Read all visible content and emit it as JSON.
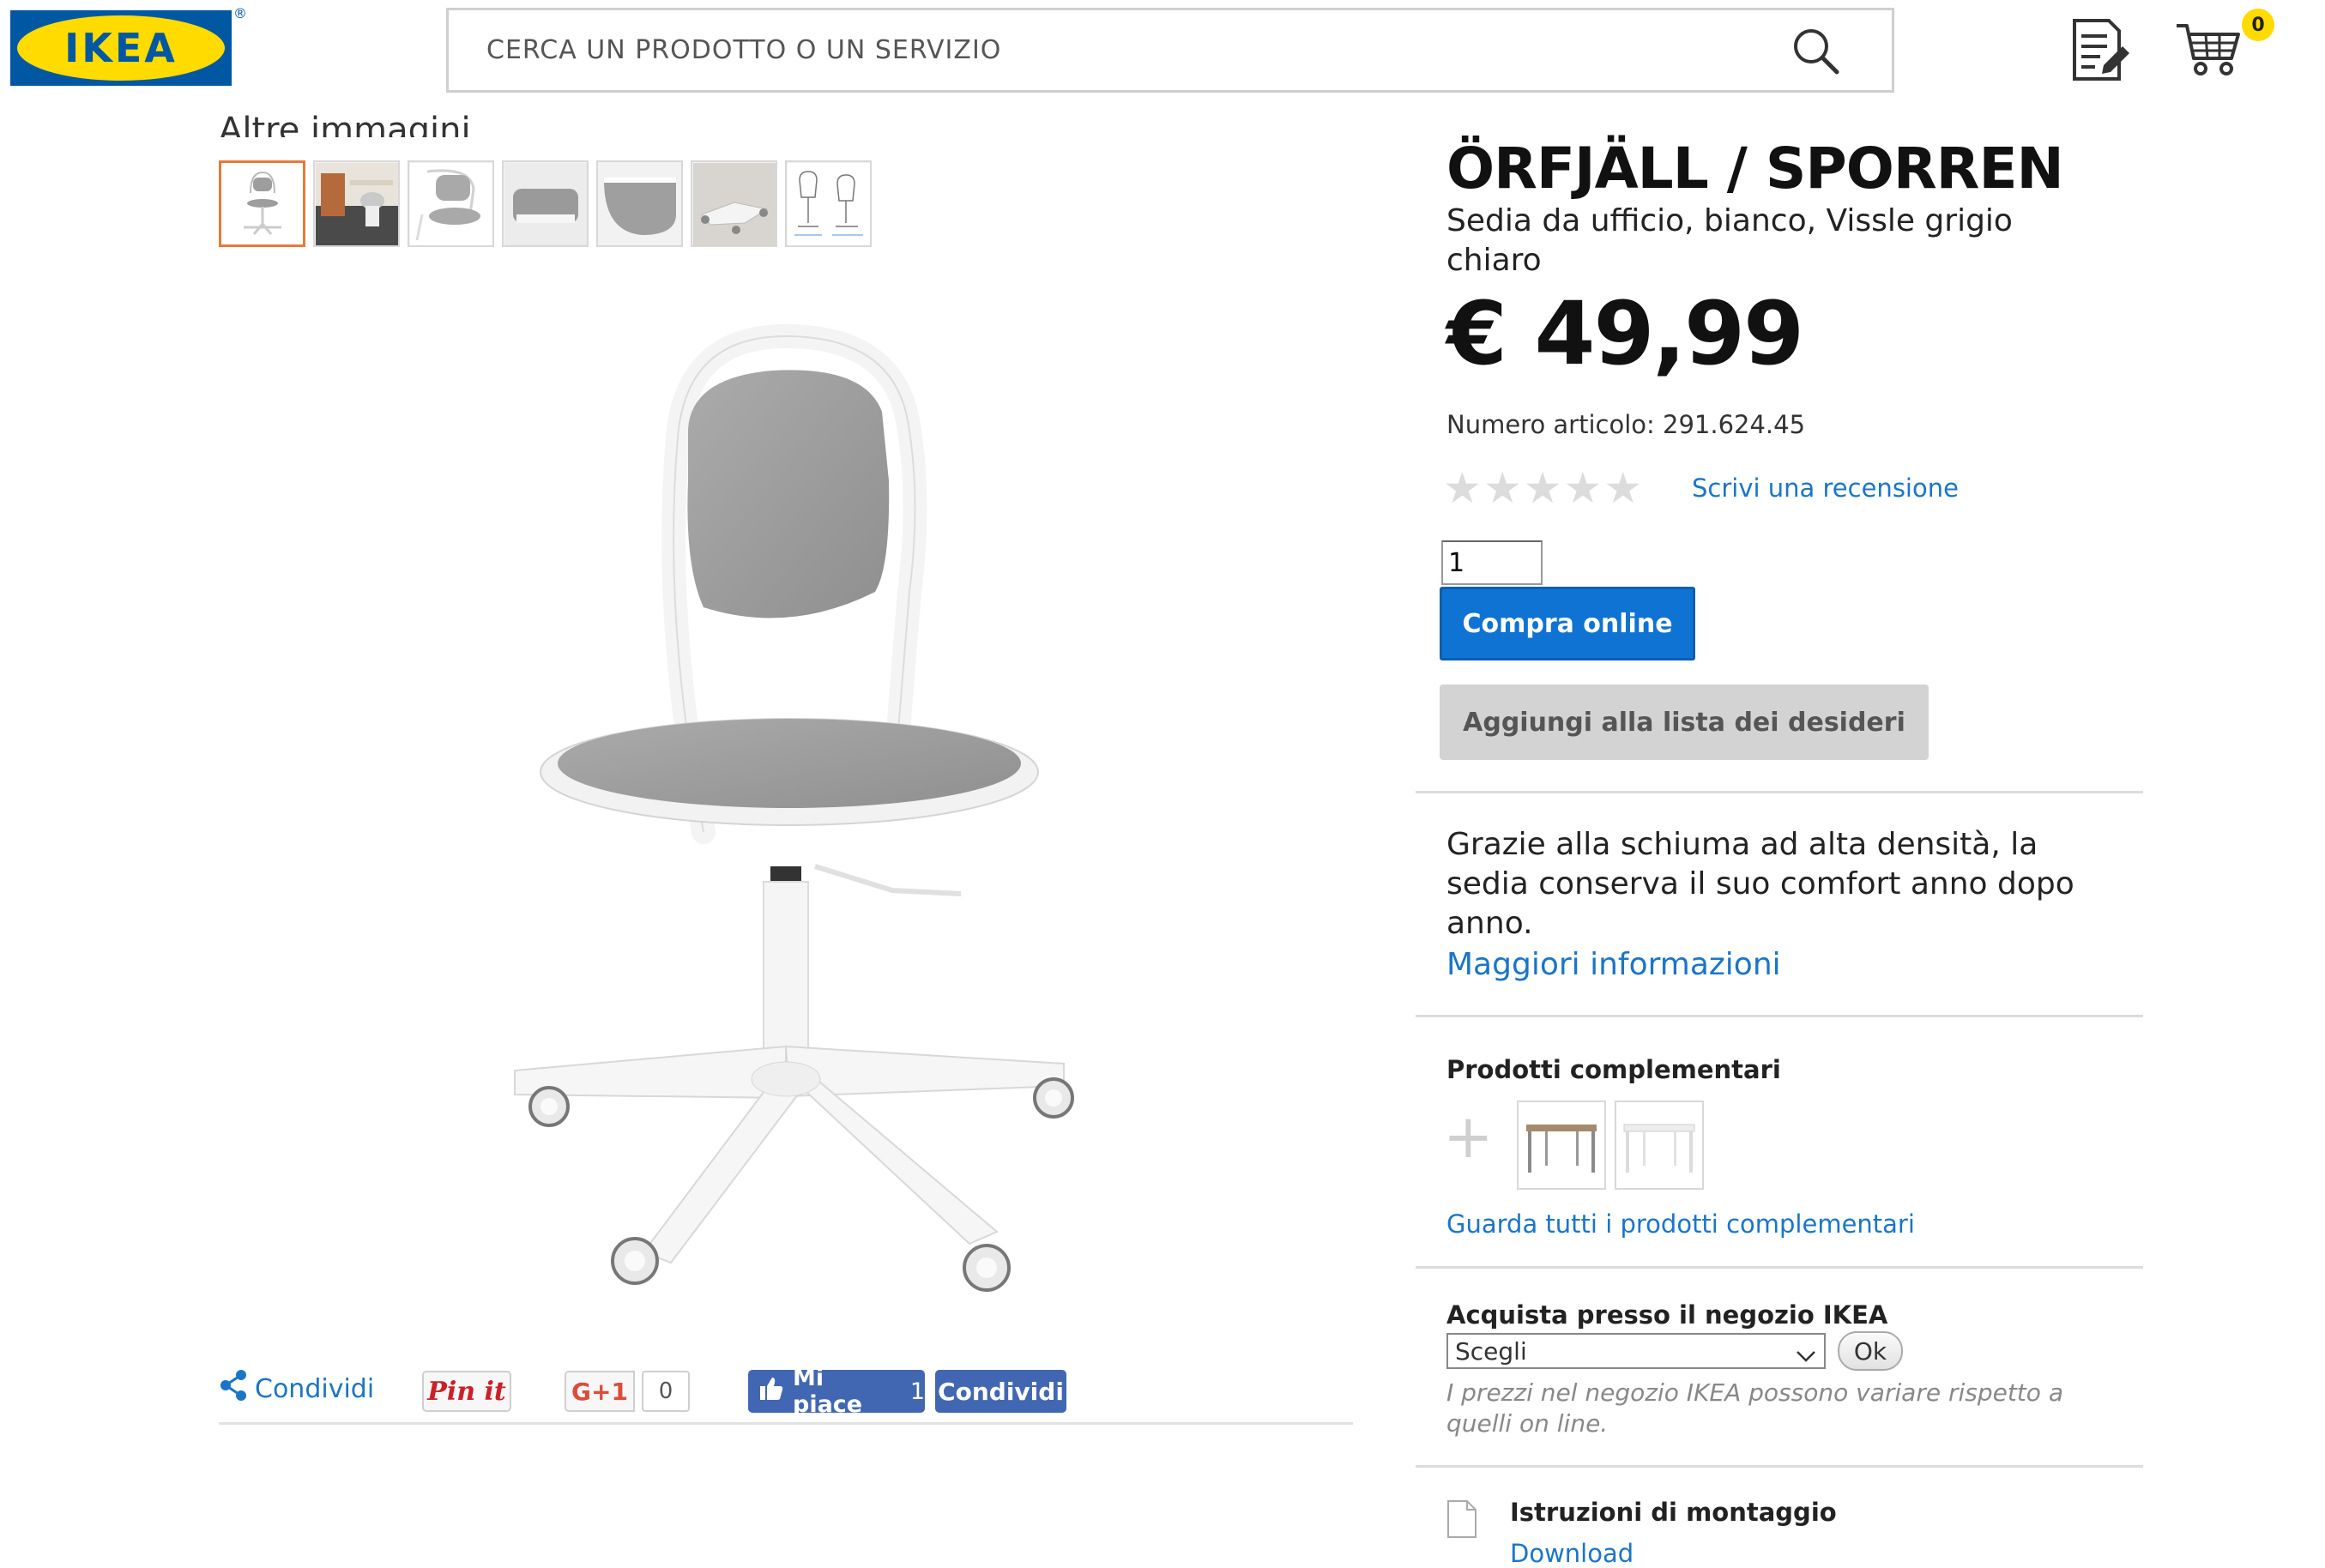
{
  "header": {
    "logo_text": "IKEA",
    "search_placeholder": "CERCA UN PRODOTTO O UN SERVIZIO",
    "cart_count": "0",
    "brand_colors": {
      "blue": "#0058a3",
      "yellow": "#ffdb00"
    }
  },
  "gallery": {
    "more_images_label": "Altre immagini",
    "thumbnails": [
      "chair-front",
      "chair-in-room",
      "chair-angle",
      "seat-detail",
      "seat-closeup",
      "base-detail",
      "dimensions-drawing"
    ],
    "selected_index": 0
  },
  "share": {
    "share_label": "Condividi",
    "pinterest_label": "Pin it",
    "gplus_label": "G+1",
    "gplus_count": "0",
    "fb_like_label": "Mi piace",
    "fb_like_count": "1",
    "fb_share_label": "Condividi"
  },
  "product": {
    "name": "ÖRFJÄLL / SPORREN",
    "subtitle": "Sedia da ufficio, bianco, Vissle grigio chiaro",
    "price": "€ 49,99",
    "article_number": "Numero articolo: 291.624.45",
    "rating_stars": 0,
    "rating_max": 5,
    "write_review": "Scrivi una recensione",
    "quantity": "1",
    "buy_label": "Compra online",
    "wishlist_label": "Aggiungi alla lista dei desideri",
    "description": "Grazie alla schiuma ad alta densità, la sedia conserva il suo comfort anno dopo anno.",
    "more_info": "Maggiori informazioni"
  },
  "complementary": {
    "title": "Prodotti complementari",
    "items": [
      "desk-wood",
      "desk-white"
    ],
    "see_all": "Guarda tutti i prodotti complementari"
  },
  "store": {
    "title": "Acquista presso il negozio IKEA",
    "select_value": "Scegli",
    "ok_label": "Ok",
    "note": "I prezzi nel negozio IKEA possono variare rispetto a quelli on line."
  },
  "assembly": {
    "title": "Istruzioni di montaggio",
    "download": "Download"
  }
}
